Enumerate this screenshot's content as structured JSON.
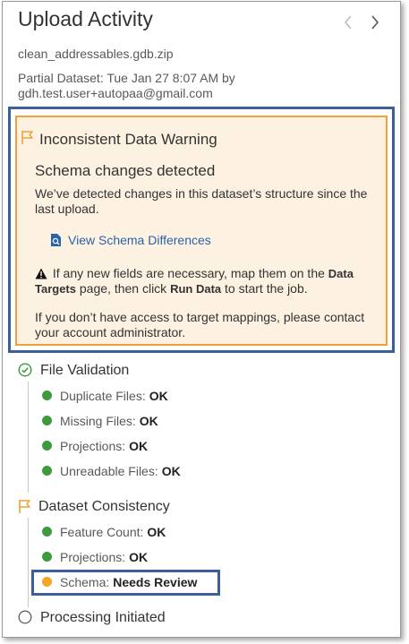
{
  "header": {
    "title": "Upload Activity"
  },
  "meta": {
    "filename": "clean_addressables.gdb.zip",
    "dataset_line": "Partial Dataset: Tue Jan 27 8:07 AM by",
    "user_line": "gdh.test.user+autopaa@gmail.com"
  },
  "warning": {
    "title": "Inconsistent Data Warning",
    "schema_heading": "Schema changes detected",
    "schema_desc": "We’ve detected changes in this dataset’s structure since the last upload.",
    "link_label": "View Schema Differences",
    "instr_pre": "If any new fields are necessary, map them on the",
    "instr_data_targets": "Data Targets",
    "instr_mid": "page, then click",
    "instr_run_data": "Run Data",
    "instr_post": "to start the job.",
    "contact_note": "If you don’t have access to target mappings, please contact your account administrator."
  },
  "file_validation": {
    "title": "File Validation",
    "items": [
      {
        "label": "Duplicate Files:",
        "status": "OK"
      },
      {
        "label": "Missing Files:",
        "status": "OK"
      },
      {
        "label": "Projections:",
        "status": "OK"
      },
      {
        "label": "Unreadable Files:",
        "status": "OK"
      }
    ]
  },
  "dataset_consistency": {
    "title": "Dataset Consistency",
    "items": [
      {
        "label": "Feature Count:",
        "status": "OK"
      },
      {
        "label": "Projections:",
        "status": "OK"
      },
      {
        "label": "Schema:",
        "status": "Needs Review"
      }
    ]
  },
  "processing": {
    "title": "Processing Initiated"
  },
  "colors": {
    "ok": "#3d9a3d",
    "warn": "#f5a623",
    "warning_border": "#f0a23a",
    "warning_bg": "#fdf1e2",
    "link": "#2a63a8",
    "highlight": "#3a5f9a"
  }
}
